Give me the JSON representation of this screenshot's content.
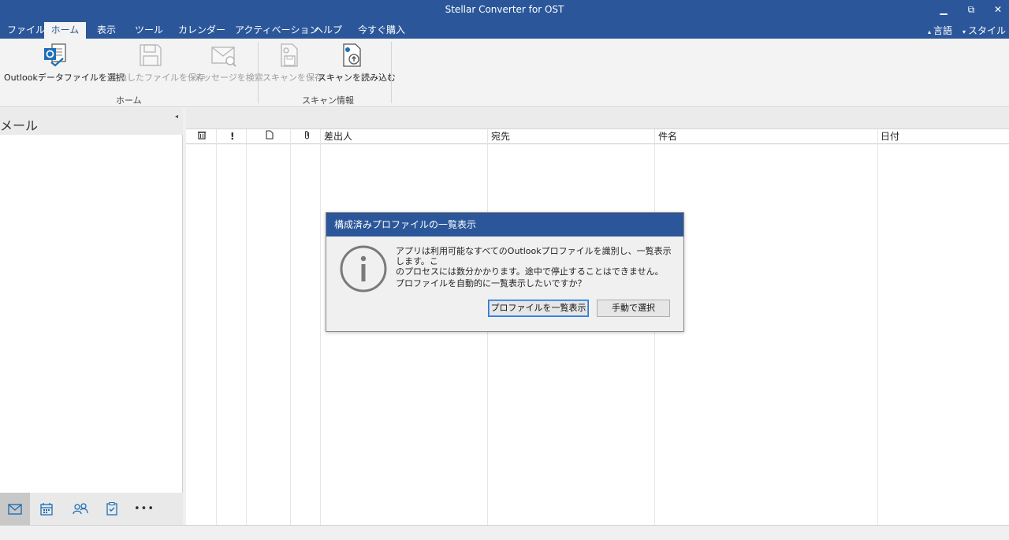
{
  "window": {
    "title": "Stellar Converter for OST",
    "minimize": "▁",
    "restore": "⧉",
    "close": "✕"
  },
  "menu": {
    "items": [
      "ファイル",
      "ホーム",
      "表示",
      "ツール",
      "カレンダー",
      "アクティベーション",
      "ヘルプ",
      "今すぐ購入"
    ],
    "active_index": 1,
    "language": "言語",
    "style": "スタイル"
  },
  "ribbon": {
    "home_group": {
      "label": "ホーム",
      "buttons": [
        {
          "label": "Outlookデータファイルを選択",
          "icon": "outlook-file-icon",
          "enabled": true
        },
        {
          "label": "変換したファイルを保存",
          "icon": "save-disk-icon",
          "enabled": false
        },
        {
          "label": "メッセージを検索",
          "icon": "search-message-icon",
          "enabled": false
        }
      ]
    },
    "scan_group": {
      "label": "スキャン情報",
      "buttons": [
        {
          "label": "スキャンを保存",
          "icon": "save-scan-icon",
          "enabled": false
        },
        {
          "label": "スキャンを読み込む",
          "icon": "load-scan-icon",
          "enabled": true
        }
      ]
    }
  },
  "left_pane": {
    "title": "メール",
    "collapse": "◂",
    "nav": [
      {
        "icon": "mail-icon",
        "active": true
      },
      {
        "icon": "calendar-icon",
        "active": false
      },
      {
        "icon": "contacts-icon",
        "active": false
      },
      {
        "icon": "tasks-icon",
        "active": false
      },
      {
        "icon": "more-icon",
        "label": "•••",
        "active": false
      }
    ]
  },
  "grid": {
    "columns": {
      "delete": "🗑",
      "importance": "!",
      "attachment_icon": "paperclip-icon",
      "from": "差出人",
      "to": "宛先",
      "subject": "件名",
      "date": "日付"
    }
  },
  "dialog": {
    "title": "構成済みプロファイルの一覧表示",
    "message_line1": "アプリは利用可能なすべてのOutlookプロファイルを識別し、一覧表示します。こ",
    "message_line2": "のプロセスには数分かかります。途中で停止することはできません。",
    "question": "プロファイルを自動的に一覧表示したいですか？",
    "primary_button": "プロファイルを一覧表示",
    "secondary_button": "手動で選択"
  },
  "colors": {
    "accent": "#2b579a",
    "ribbon_bg": "#f3f3f3",
    "icon_blue": "#1f6fb5"
  }
}
